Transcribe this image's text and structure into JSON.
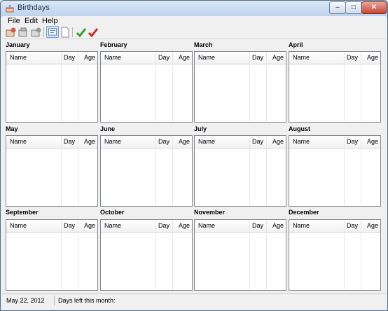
{
  "window": {
    "title": "Birthdays",
    "min_glyph": "–",
    "max_glyph": "□",
    "close_glyph": "✕"
  },
  "menu": [
    "File",
    "Edit",
    "Help"
  ],
  "toolbar": {
    "icons": [
      "add-birthday-icon",
      "edit-birthday-icon",
      "delete-birthday-icon",
      "text-view-icon",
      "new-document-icon",
      "checkmark-green-icon",
      "checkmark-red-icon"
    ]
  },
  "columns": {
    "name": "Name",
    "day": "Day",
    "age": "Age"
  },
  "months": [
    {
      "name": "January"
    },
    {
      "name": "February"
    },
    {
      "name": "March"
    },
    {
      "name": "April"
    },
    {
      "name": "May"
    },
    {
      "name": "June"
    },
    {
      "name": "July"
    },
    {
      "name": "August"
    },
    {
      "name": "September"
    },
    {
      "name": "October"
    },
    {
      "name": "November"
    },
    {
      "name": "December"
    }
  ],
  "status": {
    "date": "May 22, 2012",
    "days_left_label": "Days left this month:"
  },
  "colors": {
    "title_bar": "#c2d6ee",
    "close_button": "#c84432",
    "check_green": "#2f9e2f",
    "check_red": "#d0262b"
  }
}
